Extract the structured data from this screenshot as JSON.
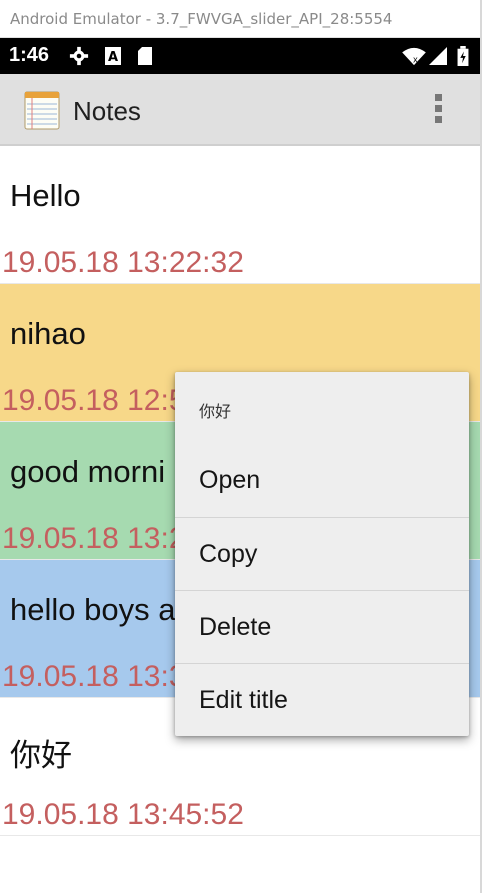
{
  "window": {
    "title": "Android Emulator - 3.7_FWVGA_slider_API_28:5554"
  },
  "status_bar": {
    "time": "1:46",
    "icons": [
      "gear-icon",
      "a-keyboard-icon",
      "sd-card-icon",
      "wifi-icon",
      "signal-icon",
      "battery-icon"
    ]
  },
  "app_bar": {
    "title": "Notes",
    "icons": [
      "notepad-logo-icon",
      "overflow-menu-icon"
    ]
  },
  "colors": {
    "date": "#c45f5f",
    "yellow": "#f7d889",
    "green": "#a6dab0",
    "blue": "#a6c9ed",
    "white": "#ffffff"
  },
  "notes": [
    {
      "title": "Hello",
      "date": "19.05.18 13:22:32",
      "color": "#ffffff"
    },
    {
      "title": "nihao",
      "date": "19.05.18 12:5",
      "color": "#f7d889"
    },
    {
      "title": "good morni",
      "date": "19.05.18 13:2",
      "color": "#a6dab0"
    },
    {
      "title": "hello boys a",
      "date": "19.05.18 13:3",
      "color": "#a6c9ed"
    },
    {
      "title": "你好",
      "date": "19.05.18 13:45:52",
      "color": "#ffffff"
    }
  ],
  "context_menu": {
    "header": "你好",
    "items": [
      "Open",
      "Copy",
      "Delete",
      "Edit title"
    ]
  }
}
